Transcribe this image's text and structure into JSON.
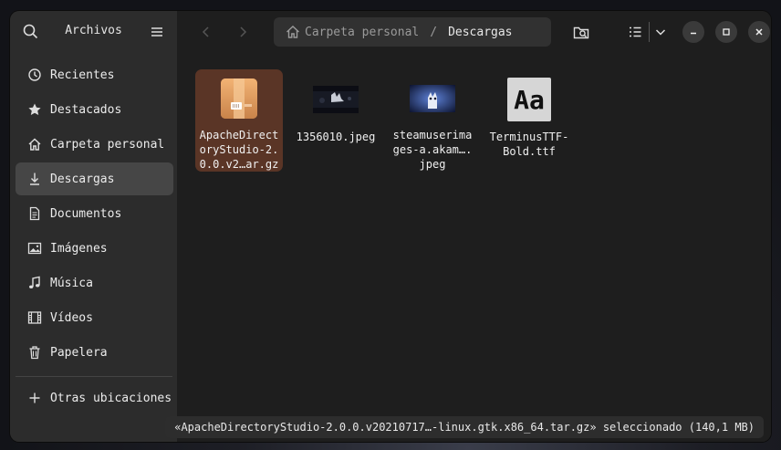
{
  "app": {
    "title": "Archivos"
  },
  "sidebar": {
    "items": [
      {
        "label": "Recientes",
        "icon": "clock-icon"
      },
      {
        "label": "Destacados",
        "icon": "star-icon"
      },
      {
        "label": "Carpeta personal",
        "icon": "home-icon"
      },
      {
        "label": "Descargas",
        "icon": "download-icon",
        "active": true
      },
      {
        "label": "Documentos",
        "icon": "document-icon"
      },
      {
        "label": "Imágenes",
        "icon": "image-icon"
      },
      {
        "label": "Música",
        "icon": "music-icon"
      },
      {
        "label": "Vídeos",
        "icon": "film-icon"
      },
      {
        "label": "Papelera",
        "icon": "trash-icon"
      }
    ],
    "other": {
      "label": "Otras ubicaciones",
      "icon": "plus-icon"
    }
  },
  "pathbar": {
    "home": "Carpeta personal",
    "separator": "/",
    "current": "Descargas"
  },
  "files": [
    {
      "name": "ApacheDirectoryStudio-2.0.0.v2…ar.gz",
      "type": "archive",
      "selected": true
    },
    {
      "name": "1356010.jpeg",
      "type": "image-dark"
    },
    {
      "name": "steamuserimages-a.akam….jpeg",
      "type": "image-blue"
    },
    {
      "name": "TerminusTTF-Bold.ttf",
      "type": "font",
      "preview": "Aa"
    }
  ],
  "status": "«ApacheDirectoryStudio-2.0.0.v20210717…-linux.gtk.x86_64.tar.gz» seleccionado (140,1 MB)",
  "colors": {
    "accent": "#5a3526",
    "sidebar": "#2c2c2c",
    "content": "#1e1e1e"
  }
}
